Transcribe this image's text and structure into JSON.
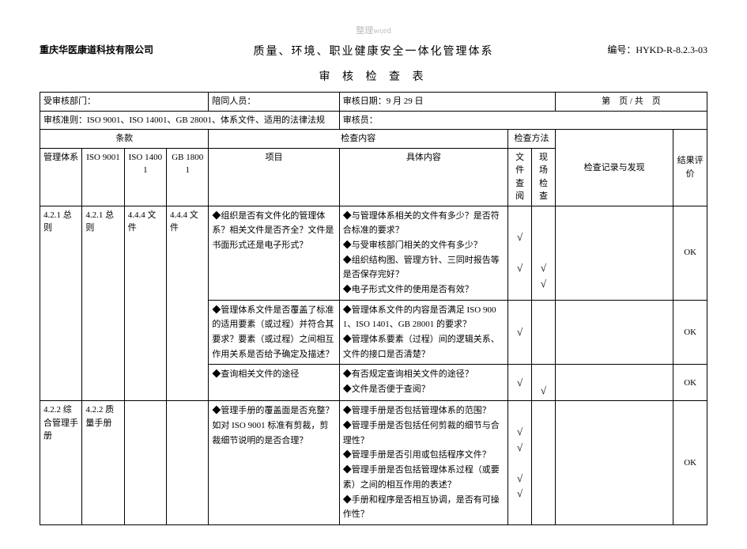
{
  "watermark": "整理word",
  "company": "重庆华医康道科技有限公司",
  "docnum_label": "编号：",
  "docnum_value": "HYKD-R-8.2.3-03",
  "title_main": "质量、环境、职业健康安全一体化管理体系",
  "title_sub": "审 核 检 查 表",
  "info": {
    "dept_label": "受审核部门：",
    "escort_label": "陪同人员：",
    "date_label": "审核日期：",
    "date_value": "9 月 29 日",
    "page_label_pre": "第",
    "page_label_mid": "页 / 共",
    "page_label_post": "页",
    "criteria_label": "审核准则：",
    "criteria_value": "ISO 9001、ISO 14001、GB 28001、体系文件、适用的法律法规",
    "auditor_label": "审核员："
  },
  "headers": {
    "clause": "条款",
    "mgmt": "管理体系",
    "iso9001": "ISO 9001",
    "iso14001": "ISO 14001",
    "gb18001": "GB 18001",
    "check_content": "检查内容",
    "project": "项目",
    "detail": "具体内容",
    "check_method": "检查方法",
    "doc_check": "文件查阅",
    "site_check": "现场检查",
    "record": "检查记录与发现",
    "result": "结果评价"
  },
  "rows": {
    "r1": {
      "c1": "4.2.1 总则",
      "c2": "4.2.1 总则",
      "c3": "4.4.4 文件",
      "c4": "4.4.4 文件",
      "project": "◆组织是否有文件化的管理体系？相关文件是否齐全？文件是书面形式还是电子形式？",
      "detail": "◆与管理体系相关的文件有多少？是否符合标准的要求？\n◆与受审核部门相关的文件有多少？\n◆组织结构图、管理方针、三同时报告等是否保存完好？\n◆电子形式文件的使用是否有效？",
      "doc_checks": "√\n\n√",
      "site_checks": "\n\n\n√\n√",
      "result": "OK"
    },
    "r2": {
      "project": "◆管理体系文件是否覆盖了标准的适用要素（或过程）并符合其要求？要素（或过程）之间相互作用关系是否给予确定及描述？",
      "detail": "◆管理体系文件的内容是否满足 ISO 9001、ISO 1401、GB 28001 的要求？\n◆管理体系要素（过程）间的逻辑关系、文件的接口是否清楚？",
      "doc_checks": "√",
      "site_checks": "",
      "result": "OK"
    },
    "r3": {
      "project": "◆查询相关文件的途径",
      "detail": "◆有否规定查询相关文件的途径？\n◆文件是否便于查阅？",
      "doc_checks": "√",
      "site_checks": "\n√",
      "result": "OK"
    },
    "r4": {
      "c1": "4.2.2 综合管理手册",
      "c2": "4.2.2 质量手册",
      "c3": "",
      "c4": "",
      "project": "◆管理手册的覆盖面是否充整？如对 ISO 9001 标准有剪裁，剪裁细节说明的是否合理？",
      "detail": "◆管理手册是否包括管理体系的范围？\n◆管理手册是否包括任何剪裁的细节与合理性？\n◆管理手册是否引用或包括程序文件？\n◆管理手册是否包括管理体系过程（或要素）之间的相互作用的表述？\n◆手册和程序是否相互协调，是否有可操作性？",
      "doc_checks": "√\n√\n\n√\n√",
      "site_checks": "",
      "result": "OK"
    }
  }
}
